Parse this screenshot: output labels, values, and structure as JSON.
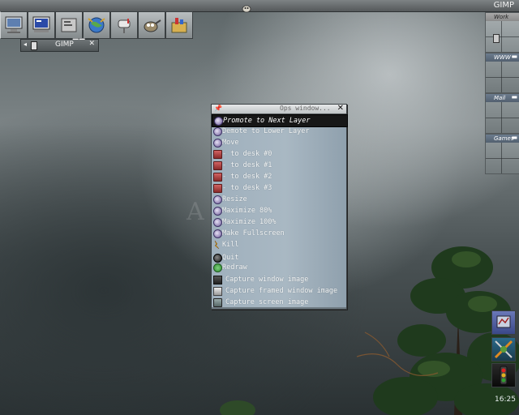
{
  "topbar": {
    "title": "GIMP"
  },
  "launcher": {
    "icons": [
      "monitor-icon",
      "terminal-icon",
      "file-manager-icon",
      "globe-icon",
      "mailbox-icon",
      "gimp-icon",
      "package-icon"
    ]
  },
  "gimp_window": {
    "label": "GIMP"
  },
  "pager": {
    "desks": [
      {
        "label": "Work"
      },
      {
        "label": "WWW"
      },
      {
        "label": "Mail"
      },
      {
        "label": "Games"
      }
    ]
  },
  "watermark": "A",
  "window_menu": {
    "title": "Ops window...",
    "items": [
      {
        "label": "Promote to Next Layer",
        "icon": "layer-icon"
      },
      {
        "label": "Demote to Lower Layer",
        "icon": "layer-icon"
      },
      {
        "label": "Move",
        "icon": "move-icon"
      },
      {
        "label": " - to desk #0",
        "icon": "desk-icon"
      },
      {
        "label": " - to desk #1",
        "icon": "desk-icon"
      },
      {
        "label": " - to desk #2",
        "icon": "desk-icon"
      },
      {
        "label": " - to desk #3",
        "icon": "desk-icon"
      },
      {
        "label": "Resize",
        "icon": "resize-icon"
      },
      {
        "label": "Maximize 80%",
        "icon": "maximize-icon"
      },
      {
        "label": "Maximize 100%",
        "icon": "maximize-icon"
      },
      {
        "label": "Make Fullscreen",
        "icon": "fullscreen-icon"
      },
      {
        "label": "Kill",
        "icon": "kill-icon"
      },
      {
        "label": "Quit",
        "icon": "quit-icon"
      },
      {
        "label": "Redraw",
        "icon": "redraw-icon"
      },
      {
        "label": "Capture window image",
        "icon": "capture-window-icon"
      },
      {
        "label": "Capture framed window image",
        "icon": "capture-framed-icon"
      },
      {
        "label": "Capture screen image",
        "icon": "capture-screen-icon"
      }
    ]
  },
  "clock": {
    "time": "16:25"
  }
}
